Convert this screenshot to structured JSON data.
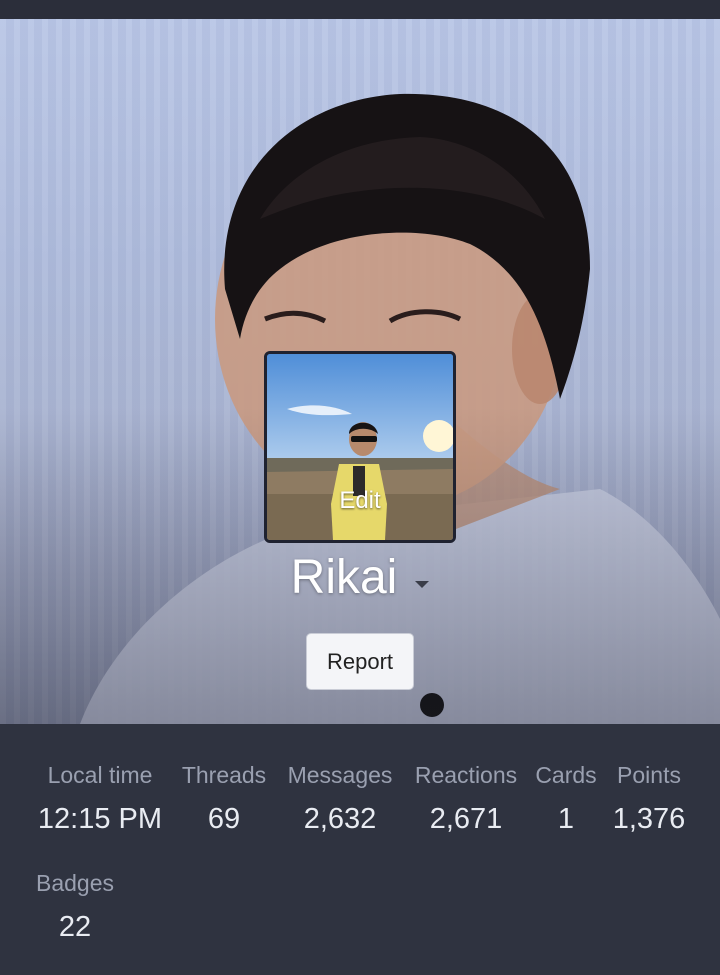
{
  "profile": {
    "username": "Rikai",
    "avatar_overlay": "Edit",
    "report_label": "Report"
  },
  "icons": {
    "username_menu": "caret-down-icon"
  },
  "stats": [
    {
      "label": "Local time",
      "value": "12:15 PM"
    },
    {
      "label": "Threads",
      "value": "69"
    },
    {
      "label": "Messages",
      "value": "2,632"
    },
    {
      "label": "Reactions",
      "value": "2,671"
    },
    {
      "label": "Cards",
      "value": "1"
    },
    {
      "label": "Points",
      "value": "1,376"
    },
    {
      "label": "Badges",
      "value": "22"
    }
  ],
  "colors": {
    "stats_background": "#2f3340",
    "label": "#9aa0b0",
    "value": "#e9ecf2"
  }
}
